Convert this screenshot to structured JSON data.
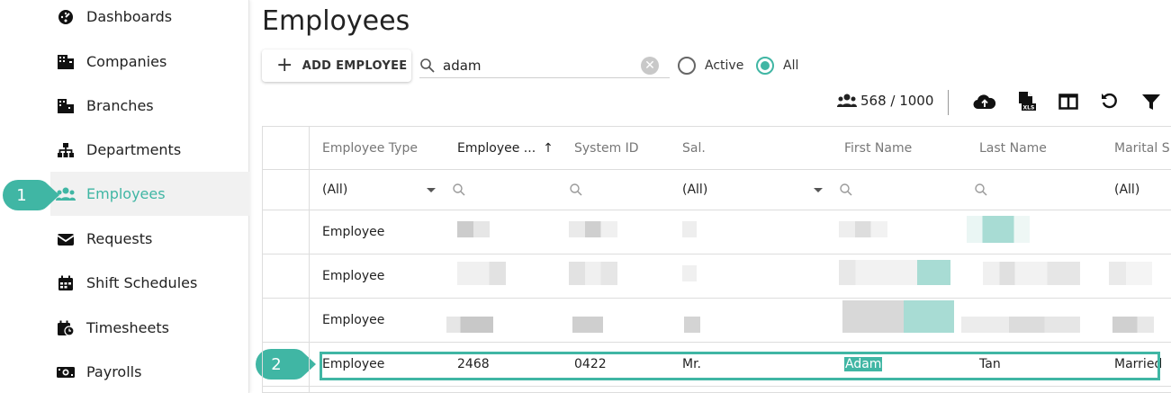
{
  "sidebar": {
    "items": [
      {
        "label": "Dashboards",
        "icon": "dashboard-icon"
      },
      {
        "label": "Companies",
        "icon": "companies-icon"
      },
      {
        "label": "Branches",
        "icon": "branches-icon"
      },
      {
        "label": "Departments",
        "icon": "departments-icon"
      },
      {
        "label": "Employees",
        "icon": "employees-icon"
      },
      {
        "label": "Requests",
        "icon": "requests-icon"
      },
      {
        "label": "Shift Schedules",
        "icon": "calendar-icon"
      },
      {
        "label": "Timesheets",
        "icon": "timesheet-icon"
      },
      {
        "label": "Payrolls",
        "icon": "payroll-icon"
      }
    ]
  },
  "callouts": {
    "one": "1",
    "two": "2"
  },
  "page": {
    "title": "Employees"
  },
  "toolbar": {
    "add_label": "ADD EMPLOYEE",
    "search_value": "adam",
    "filter_active": "Active",
    "filter_all": "All",
    "record_count": "568 / 1000"
  },
  "grid": {
    "headers": [
      "Employee Type",
      "Employee ...",
      "System ID",
      "Sal.",
      "First Name",
      "Last Name",
      "Marital S"
    ],
    "sort_indicator": "↑",
    "filters": {
      "type": "(All)",
      "salutation": "(All)",
      "marital": "(All)"
    },
    "rows": [
      {
        "type": "Employee"
      },
      {
        "type": "Employee"
      },
      {
        "type": "Employee"
      },
      {
        "type": "Employee",
        "employee_id": "2468",
        "system_id": "0422",
        "salutation": "Mr.",
        "first_name": "Adam",
        "last_name": "Tan",
        "marital": "Married"
      }
    ]
  },
  "colors": {
    "accent": "#40b6a4",
    "active_bg": "#f1f1f1"
  }
}
